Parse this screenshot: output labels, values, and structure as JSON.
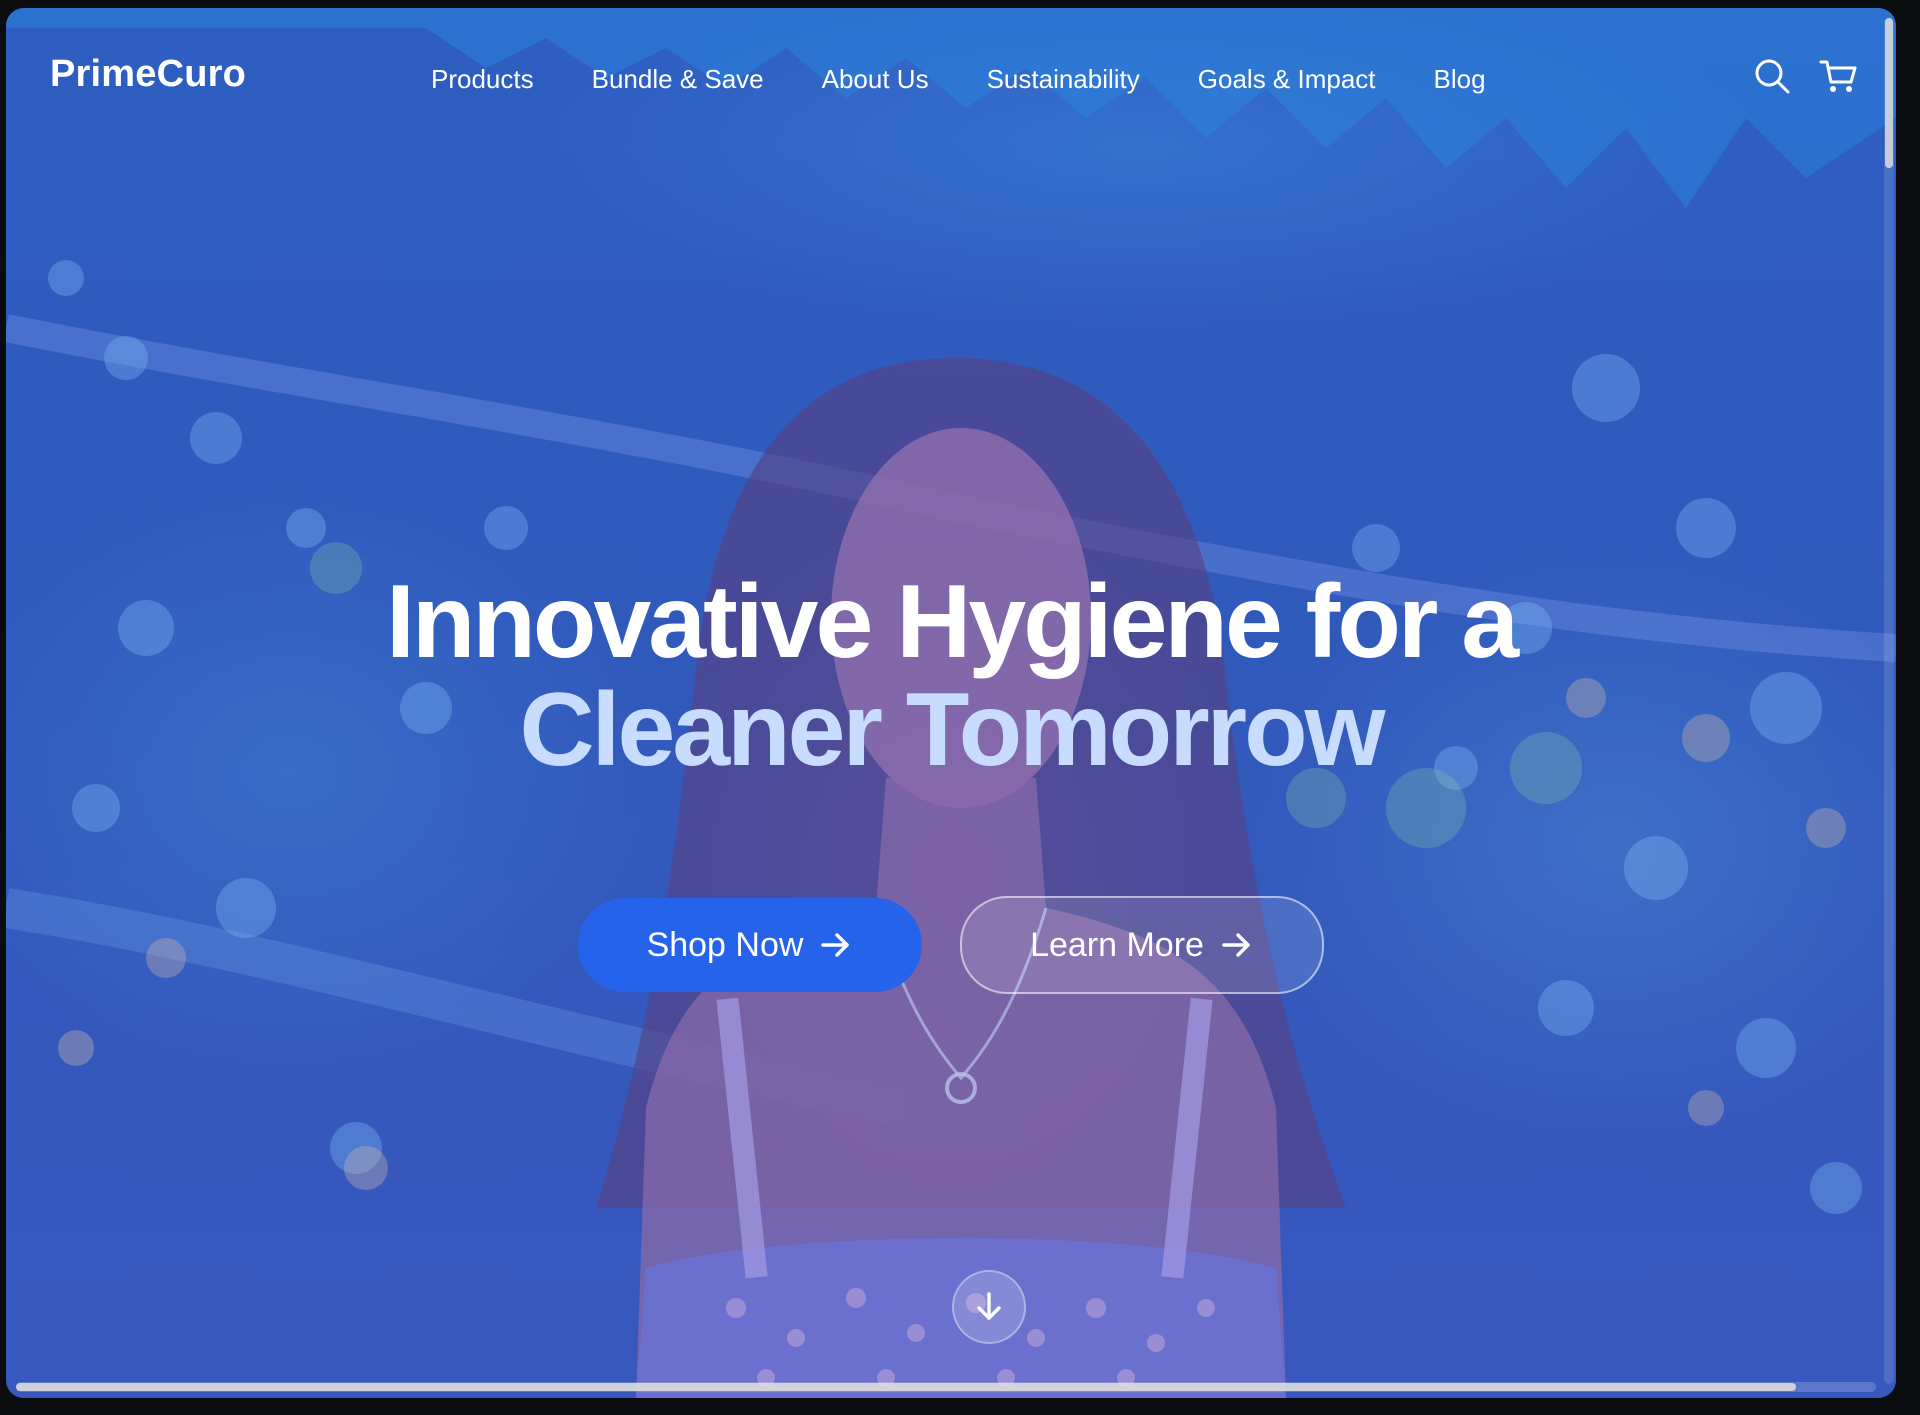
{
  "brand": {
    "name": "PrimeCuro"
  },
  "nav": {
    "items": [
      {
        "label": "Products"
      },
      {
        "label": "Bundle & Save"
      },
      {
        "label": "About Us"
      },
      {
        "label": "Sustainability"
      },
      {
        "label": "Goals & Impact"
      },
      {
        "label": "Blog"
      }
    ]
  },
  "header": {
    "search_icon": "search-icon",
    "cart_icon": "cart-icon"
  },
  "hero": {
    "title_line1": "Innovative Hygiene for a",
    "title_line2": "Cleaner Tomorrow",
    "primary_cta": "Shop Now",
    "secondary_cta": "Learn More",
    "scroll_icon": "arrow-down-icon"
  },
  "colors": {
    "accent": "#2563eb",
    "title_highlight": "#c8dcff",
    "overlay_blue": "#3659d2"
  }
}
